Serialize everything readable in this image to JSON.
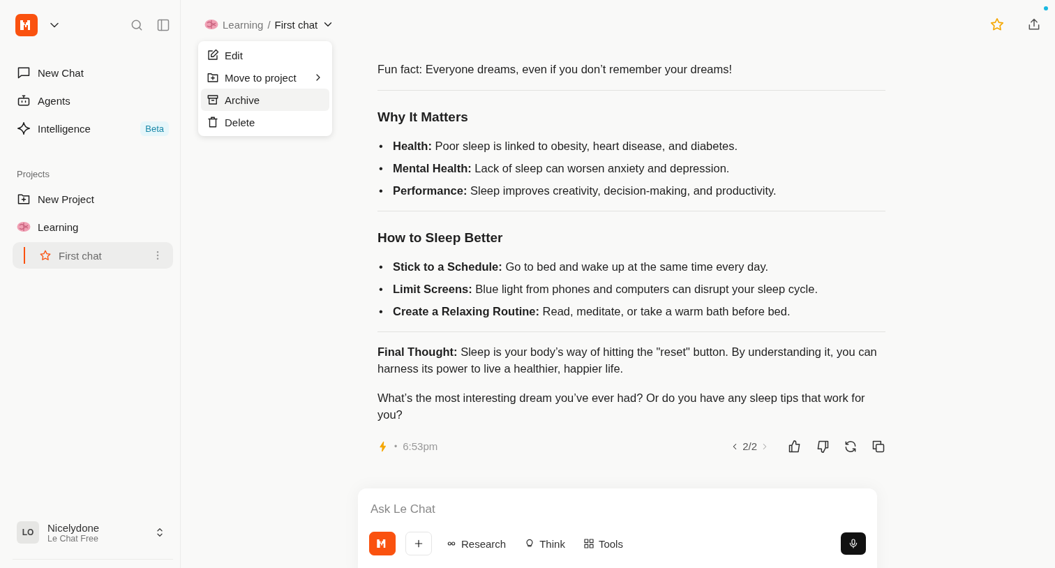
{
  "sidebar": {
    "nav": [
      {
        "label": "New Chat"
      },
      {
        "label": "Agents"
      },
      {
        "label": "Intelligence",
        "badge": "Beta"
      }
    ],
    "projects_heading": "Projects",
    "projects": [
      {
        "label": "New Project",
        "kind": "action"
      },
      {
        "label": "Learning",
        "kind": "project",
        "children": [
          {
            "label": "First chat",
            "selected": true
          }
        ]
      }
    ],
    "user": {
      "initials": "LO",
      "name": "Nicelydone",
      "plan": "Le Chat Free"
    }
  },
  "breadcrumb": {
    "project": "Learning",
    "separator": "/",
    "chat": "First chat"
  },
  "menu": [
    {
      "label": "Edit",
      "submenu": false,
      "selected": false
    },
    {
      "label": "Move to project",
      "submenu": true,
      "selected": false
    },
    {
      "label": "Archive",
      "submenu": false,
      "selected": true
    },
    {
      "label": "Delete",
      "submenu": false,
      "selected": false
    }
  ],
  "message": {
    "blocks": [
      {
        "kind": "paragraph",
        "text": "Fun fact: Everyone dreams, even if you don’t remember your dreams!"
      },
      {
        "kind": "rule"
      },
      {
        "kind": "heading",
        "text": "Why It Matters"
      },
      {
        "kind": "bullets",
        "marker": "•",
        "items": [
          "**Health:** Poor sleep is linked to obesity, heart disease, and diabetes.",
          "**Mental Health:** Lack of sleep can worsen anxiety and depression.",
          "**Performance:** Sleep improves creativity, decision-making, and productivity."
        ]
      },
      {
        "kind": "rule"
      },
      {
        "kind": "heading",
        "text": "How to Sleep Better"
      },
      {
        "kind": "bullets",
        "marker": "•",
        "items": [
          "**Stick to a Schedule:** Go to bed and wake up at the same time every day.",
          "**Limit Screens:** Blue light from phones and computers can disrupt your sleep cycle.",
          "**Create a Relaxing Routine:** Read, meditate, or take a warm bath before bed."
        ]
      },
      {
        "kind": "rule"
      },
      {
        "kind": "paragraph",
        "text": "**Final Thought:** Sleep is your body’s way of hitting the \"reset\" button. By understanding it, you can harness its power to live a healthier, happier life."
      },
      {
        "kind": "paragraph",
        "text": "What’s the most interesting dream you’ve ever had? Or do you have any sleep tips that work for you?"
      }
    ],
    "separator": "•",
    "time": "6:53pm",
    "pager": "2/2"
  },
  "composer": {
    "placeholder": "Ask Le Chat",
    "tools": [
      "Research",
      "Think",
      "Tools"
    ]
  }
}
